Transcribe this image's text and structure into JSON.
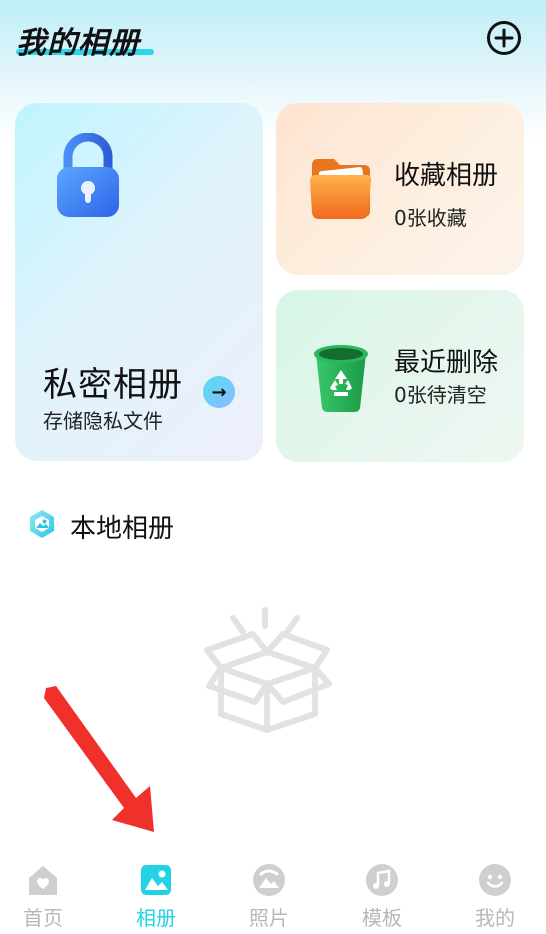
{
  "header": {
    "title": "我的相册",
    "add_icon": "plus-circle-icon"
  },
  "cards": {
    "private": {
      "title": "私密相册",
      "subtitle": "存储隐私文件",
      "icon": "lock-icon",
      "action_icon": "arrow-right-icon"
    },
    "favorites": {
      "title": "收藏相册",
      "subtitle": "0张收藏",
      "icon": "folder-icon"
    },
    "recently_deleted": {
      "title": "最近删除",
      "subtitle": "0张待清空",
      "icon": "recycle-bin-icon"
    }
  },
  "local_album": {
    "title": "本地相册",
    "icon": "photo-icon",
    "empty_state_icon": "empty-box-icon"
  },
  "tabbar": {
    "active": "相册",
    "active_color": "#22d3e6",
    "items": [
      {
        "label": "首页",
        "icon": "home-icon"
      },
      {
        "label": "相册",
        "icon": "album-icon"
      },
      {
        "label": "照片",
        "icon": "camera-lens-icon"
      },
      {
        "label": "模板",
        "icon": "music-note-icon"
      },
      {
        "label": "我的",
        "icon": "smiley-icon"
      }
    ]
  }
}
